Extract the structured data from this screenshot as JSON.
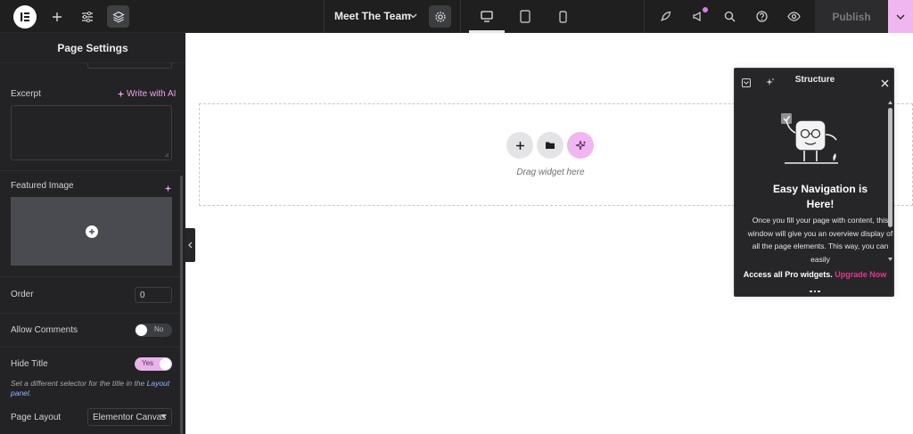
{
  "topbar": {
    "document_title": "Meet The Team",
    "publish_label": "Publish",
    "icons": [
      "elementor-logo-icon",
      "add-element-icon",
      "site-settings-icon",
      "structure-layers-icon",
      "page-settings-gear-icon",
      "desktop-icon",
      "tablet-icon",
      "mobile-icon",
      "rocket-icon",
      "announcements-icon",
      "search-icon",
      "help-icon",
      "preview-eye-icon",
      "chevron-down-icon"
    ]
  },
  "panel": {
    "title": "Page Settings",
    "excerpt_label": "Excerpt",
    "write_with_ai": "Write with AI",
    "featured_image_label": "Featured Image",
    "order_label": "Order",
    "order_value": "0",
    "allow_comments_label": "Allow Comments",
    "allow_comments_value": "No",
    "hide_title_label": "Hide Title",
    "hide_title_value": "Yes",
    "hint_text": "Set a different selector for the title in the ",
    "hint_link_1": "Layout",
    "hint_link_2": "panel",
    "hint_end": ".",
    "page_layout_label": "Page Layout",
    "page_layout_value": "Elementor Canvas"
  },
  "canvas": {
    "drag_text": "Drag widget here"
  },
  "structure": {
    "title": "Structure",
    "heading_line1": "Easy Navigation is",
    "heading_line2": "Here!",
    "description": "Once you fill your page with content, this window will give you an overview display of all the page elements. This way, you can easily",
    "promo_text": "Access all Pro widgets.",
    "promo_link": "Upgrade Now"
  },
  "colors": {
    "accent_pink": "#f0b6ef",
    "ai_pink": "#e8a4e9",
    "upgrade_pink": "#e2388f",
    "panel_bg": "#232325"
  }
}
